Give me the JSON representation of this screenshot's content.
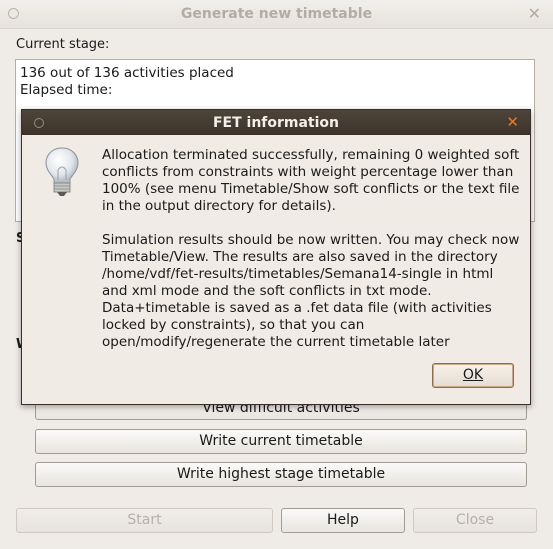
{
  "window": {
    "title": "Generate new timetable"
  },
  "current_stage": {
    "label": "Current stage:",
    "line1": "136 out of 136 activities placed",
    "line2": "Elapsed time:"
  },
  "partial_labels": {
    "s": "S",
    "w": "W"
  },
  "buttons": {
    "view_difficult": "View difficult activities",
    "write_current": "Write current timetable",
    "write_highest": "Write highest stage timetable",
    "start": "Start",
    "help": "Help",
    "close": "Close"
  },
  "dialog": {
    "title": "FET information",
    "paragraph1": "Allocation terminated successfully, remaining 0 weighted soft conflicts from constraints with weight percentage lower than 100% (see menu Timetable/Show soft conflicts or the text file in the output directory for details).",
    "paragraph2": "Simulation results should be now written. You may check now Timetable/View. The results are also saved in the directory /home/vdf/fet-results/timetables/Semana14-single in html and xml mode and the soft conflicts in txt mode. Data+timetable is saved as a .fet data file (with activities locked by constraints), so that you can open/modify/regenerate the current timetable later",
    "ok_label": "OK",
    "icon": "lightbulb-icon"
  }
}
